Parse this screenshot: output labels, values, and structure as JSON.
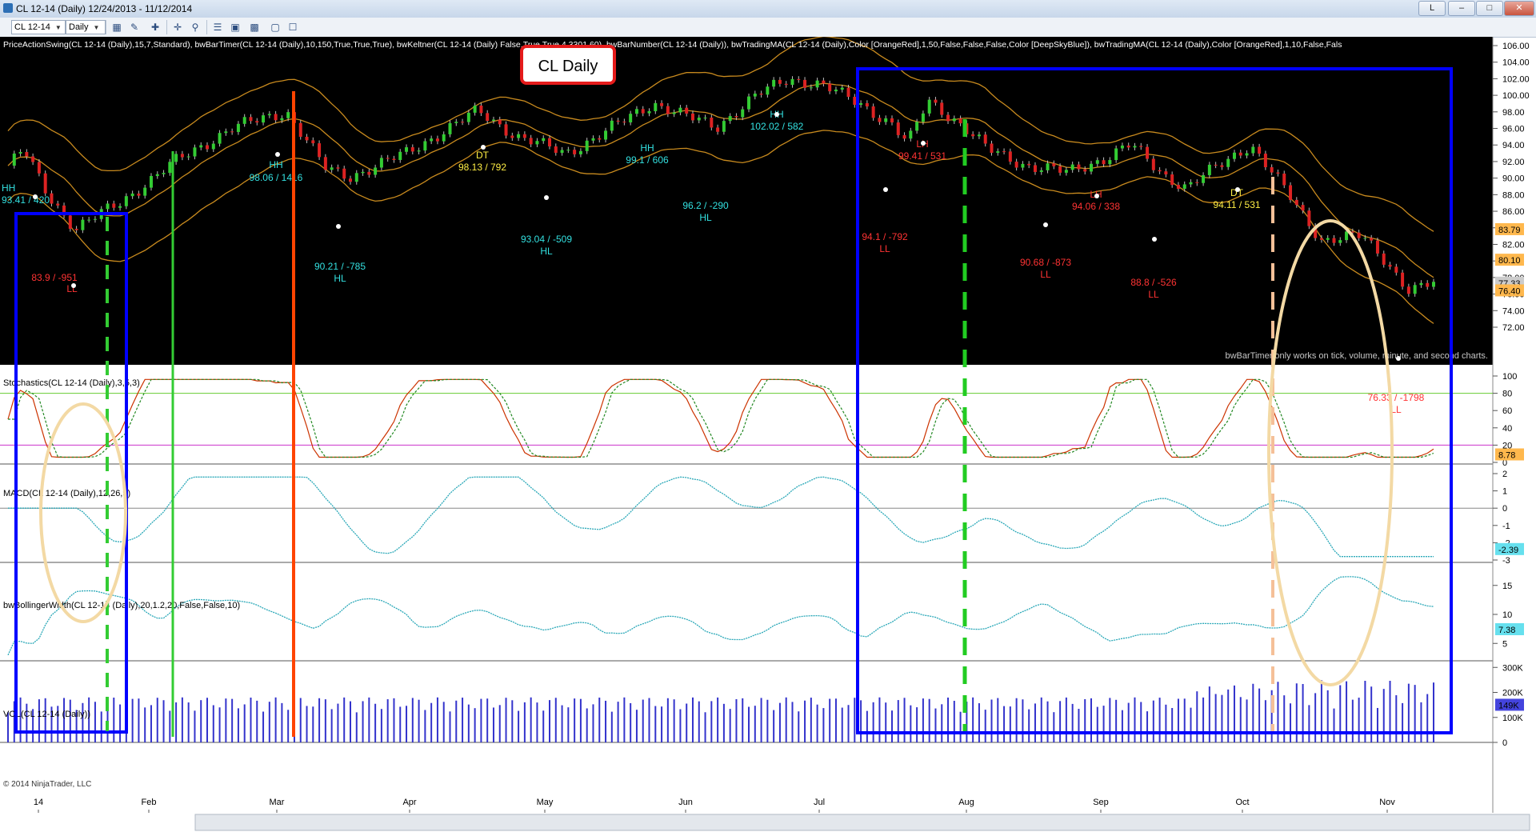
{
  "window": {
    "title": "CL 12-14 (Daily)  12/24/2013 - 11/12/2014",
    "help_button": "L",
    "minimize_icon": "minimize-icon",
    "maximize_icon": "maximize-icon",
    "close_icon": "close-icon"
  },
  "toolbar": {
    "instrument": "CL 12-14",
    "period": "Daily",
    "icons": [
      "bar-type-icon",
      "pencil-icon",
      "cursor-icon",
      "zoom-icon",
      "crosshair-icon",
      "properties-icon",
      "data-box-icon",
      "template-icon",
      "snapshot-icon",
      "close-chart-icon"
    ]
  },
  "chart": {
    "indicator_header": "PriceActionSwing(CL 12-14 (Daily),15,7,Standard), bwBarTimer(CL 12-14 (Daily),10,150,True,True,True), bwKeltner(CL 12-14 (Daily)                    False,True,True,4.3301,60), bwBarNumber(CL 12-14 (Daily)), bwTradingMA(CL 12-14 (Daily),Color [OrangeRed],1,50,False,False,False,Color [DeepSkyBlue]), bwTradingMA(CL 12-14 (Daily),Color [OrangeRed],1,10,False,Fals",
    "chart_label": "CL Daily",
    "bar_timer_note": "bwBarTimer only works on tick, volume, minute, and second charts.",
    "copyright": "© 2014 NinjaTrader, LLC",
    "price_axis": [
      "106.00",
      "104.00",
      "102.00",
      "100.00",
      "98.00",
      "96.00",
      "94.00",
      "92.00",
      "90.00",
      "88.00",
      "86.00",
      "84.00",
      "82.00",
      "80.00",
      "78.00",
      "76.00",
      "74.00",
      "72.00"
    ],
    "price_markers": [
      {
        "value": "83.79",
        "color": "#ffb84d"
      },
      {
        "value": "80.10",
        "color": "#ffb84d"
      },
      {
        "value": "77.33",
        "color": "#cccccc"
      },
      {
        "value": "76.40",
        "color": "#ffb84d"
      }
    ],
    "swing_labels": [
      {
        "text": "HH",
        "color": "#33e0e0"
      },
      {
        "text": "93.41 / 420",
        "color": "#33e0e0"
      },
      {
        "text": "83.9 / -951",
        "color": "#ff3333"
      },
      {
        "text": "LL",
        "color": "#ff3333"
      },
      {
        "text": "HH",
        "color": "#33e0e0"
      },
      {
        "text": "98.06 / 1416",
        "color": "#33e0e0"
      },
      {
        "text": "90.21 / -785",
        "color": "#33e0e0"
      },
      {
        "text": "HL",
        "color": "#33e0e0"
      },
      {
        "text": "DT",
        "color": "#ffee44"
      },
      {
        "text": "98.13 / 792",
        "color": "#ffee44"
      },
      {
        "text": "93.04 / -509",
        "color": "#33e0e0"
      },
      {
        "text": "HL",
        "color": "#33e0e0"
      },
      {
        "text": "HH",
        "color": "#33e0e0"
      },
      {
        "text": "99.1 / 606",
        "color": "#33e0e0"
      },
      {
        "text": "96.2 / -290",
        "color": "#33e0e0"
      },
      {
        "text": "HL",
        "color": "#33e0e0"
      },
      {
        "text": "HH",
        "color": "#33e0e0"
      },
      {
        "text": "102.02 / 582",
        "color": "#33e0e0"
      },
      {
        "text": "LH",
        "color": "#ff3333"
      },
      {
        "text": "99.41 / 531",
        "color": "#ff3333"
      },
      {
        "text": "94.1 / -792",
        "color": "#ff3333"
      },
      {
        "text": "LL",
        "color": "#ff3333"
      },
      {
        "text": "90.68 / -873",
        "color": "#ff3333"
      },
      {
        "text": "LL",
        "color": "#ff3333"
      },
      {
        "text": "LH",
        "color": "#ff3333"
      },
      {
        "text": "94.06 / 338",
        "color": "#ff3333"
      },
      {
        "text": "88.8 / -526",
        "color": "#ff3333"
      },
      {
        "text": "LL",
        "color": "#ff3333"
      },
      {
        "text": "DT",
        "color": "#ffee44"
      },
      {
        "text": "94.11 / 531",
        "color": "#ffee44"
      },
      {
        "text": "76.33 / -1798",
        "color": "#ff3333"
      },
      {
        "text": "LL",
        "color": "#ff3333"
      }
    ],
    "stoch": {
      "label": "Stochastics(CL 12-14 (Daily),3,5,3)",
      "axis": [
        "100",
        "80",
        "60",
        "40",
        "20",
        "0"
      ],
      "value": "8.78"
    },
    "macd": {
      "label": "MACD(CL 12-14 (Daily),12,26,9)",
      "axis": [
        "2",
        "1",
        "0",
        "-1",
        "-2",
        "-3"
      ],
      "value": "-2.39"
    },
    "bw": {
      "label": "bwBollingerWidth(CL 12-14 (Daily),20,1.2,20,False,False,10)",
      "axis": [
        "15",
        "10",
        "5"
      ],
      "value": "7.38"
    },
    "vol": {
      "label": "VOL(CL 12-14 (Daily))",
      "axis": [
        "300K",
        "200K",
        "100K",
        "0"
      ],
      "value": "149K"
    },
    "time_axis": [
      "14",
      "Feb",
      "Mar",
      "Apr",
      "May",
      "Jun",
      "Jul",
      "Aug",
      "Sep",
      "Oct",
      "Nov"
    ]
  },
  "colors": {
    "price_bg": "#000000",
    "up_candle": "#33cc33",
    "down_candle": "#dd2222",
    "keltner": "#c88a1e",
    "annotation_box": "#0000ff",
    "ellipse": "#f3d9a4"
  }
}
